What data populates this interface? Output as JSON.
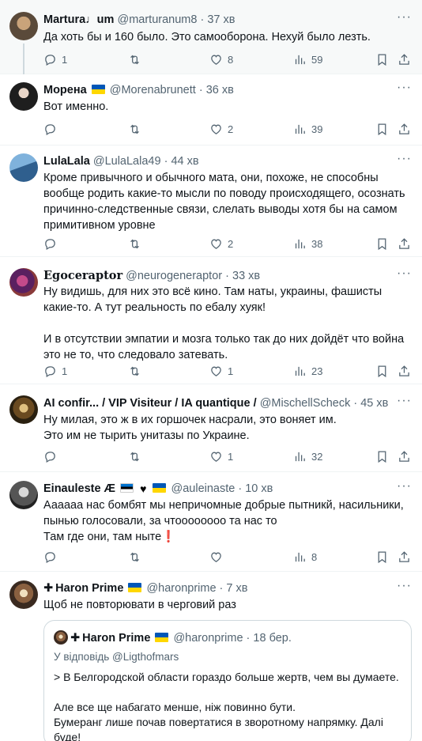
{
  "tweets": [
    {
      "name": "Martura♩um",
      "handle": "@marturanum8",
      "time": "37 хв",
      "text": "Да хоть бы и 160 было. Это самооборона. Нехуй было лезть.",
      "stats": {
        "replies": "1",
        "retweets": "",
        "likes": "8",
        "views": "59"
      },
      "avatar_color": "#5a4a3a"
    },
    {
      "name": "Морена",
      "handle": "@Morenabrunett",
      "time": "36 хв",
      "text": "Вот именно.",
      "stats": {
        "replies": "",
        "retweets": "",
        "likes": "2",
        "views": "39"
      },
      "avatar_color": "#2b2b2b"
    },
    {
      "name": "LulaLala",
      "handle": "@LulaLala49",
      "time": "44 хв",
      "text": "Кроме привычного и обычного мата, они, похоже, не способны вообще родить какие-то мысли по поводу происходящего, осознать причинно-следственные связи, слелать выводы хотя бы на самом примитивном уровне",
      "stats": {
        "replies": "",
        "retweets": "",
        "likes": "2",
        "views": "38"
      },
      "avatar_color": "#3d7ab0"
    },
    {
      "name": "Egoceraptor",
      "handle": "@neurogeneraptor",
      "time": "33 хв",
      "text": "Ну видишь, для них это всё кино. Там наты, украины, фашисты какие-то. А тут реальность по ебалу хуяк!\n\nИ в отсутствии эмпатии и мозга только так до них дойдёт что война это не то, что следовало затевать.",
      "stats": {
        "replies": "1",
        "retweets": "",
        "likes": "1",
        "views": "23"
      },
      "avatar_color": "#7a2a6a"
    },
    {
      "name": "AI confir... / VIP Visiteur / IA quantique /",
      "handle": "@MischellScheck",
      "time": "45 хв",
      "text": "Ну милая, это ж в их горшочек насрали, это воняет им.\nЭто им не тырить унитазы по Украине.",
      "stats": {
        "replies": "",
        "retweets": "",
        "likes": "1",
        "views": "32"
      },
      "avatar_color": "#8a6a30"
    },
    {
      "name": "Einauleste Æ",
      "handle": "@auleinaste",
      "time": "10 хв",
      "text": "Аааааа нас бомбят мы непричомные добрые пытникй, насильники, пынью голосовали, за чтоооооооо та нас то\nТам где они, там ныте❗",
      "stats": {
        "replies": "",
        "retweets": "",
        "likes": "",
        "views": "8"
      },
      "avatar_color": "#4a4a4a"
    },
    {
      "name": "Haron Prime",
      "handle": "@haronprime",
      "time": "7 хв",
      "text": "Щоб не повторювати в черговий раз",
      "avatar_color": "#6b5040"
    }
  ],
  "quote": {
    "name": "Haron Prime",
    "handle": "@haronprime",
    "time": "18 бер.",
    "reply_to": "У відповідь @Ligthofmars",
    "text": "> В Белгородской области гораздо больше жертв, чем вы думаете.\n\nАле все ще набагато менше, ніж повинно бути.\nБумеранг лише почав повертатися в зворотному напрямку. Далі буде!"
  },
  "separator": "·",
  "icons": [
    "reply-icon",
    "retweet-icon",
    "like-icon",
    "views-icon",
    "bookmark-icon",
    "share-icon",
    "more-icon"
  ]
}
